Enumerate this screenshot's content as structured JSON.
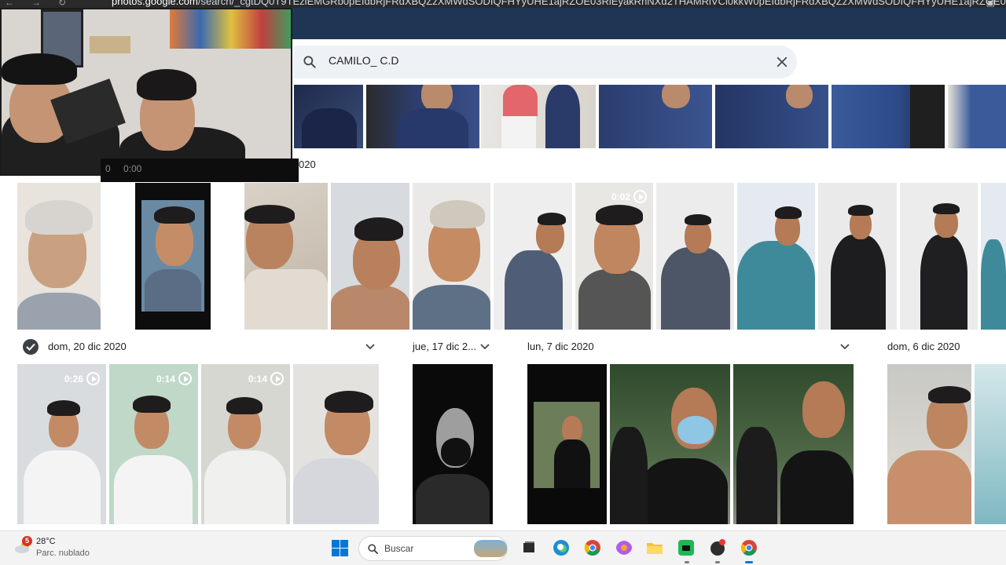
{
  "browser": {
    "url_host": "photos.google.com",
    "url_path": "/search/_cgtDQ0T9TEziEMGRb0pEIdbRjFRdXBQZzXMWdSODIQFHYyUHE1ajRZOE03RlEyakRhNXd2THAMRlVCl0kkW0pEIdbRjFRdXBQZzXMWdSODIQFHYyUHE1ajRZOE03RlEyakRh..."
  },
  "search": {
    "query": "CAMILO_ C.D",
    "clear_label": "close"
  },
  "webcam": {
    "count": "0",
    "time": "0:00",
    "year_fragment": "020"
  },
  "sections": [
    {
      "label": "dom, 20 dic 2020",
      "selected": true
    },
    {
      "label": "jue, 17 dic 2..."
    },
    {
      "label": "lun, 7 dic 2020"
    },
    {
      "label": "dom, 6 dic 2020"
    }
  ],
  "video_badges": {
    "row2_video": "0:02",
    "row3_video1": "0:26",
    "row3_video2": "0:14",
    "row3_video3": "0:14"
  },
  "taskbar": {
    "weather_temp": "28°C",
    "weather_desc": "Parc. nublado",
    "weather_badge": "5",
    "search_placeholder": "Buscar"
  },
  "colors": {
    "chrome_bar": "#1f3554",
    "search_box": "#eef2f7",
    "taskbar": "#f3f3f3"
  }
}
